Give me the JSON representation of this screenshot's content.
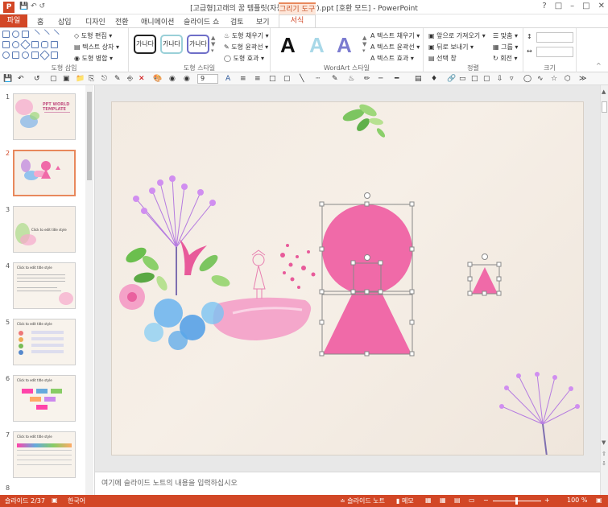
{
  "titlebar": {
    "title": "[고급형]고래의 꿈 템플릿(자동완성형포함).ppt [호환 모드] - PowerPoint",
    "help": "?",
    "min": "–",
    "max": "□",
    "close": "✕"
  },
  "tabs": {
    "file": "파일",
    "items": [
      "홈",
      "삽입",
      "디자인",
      "전환",
      "애니메이션",
      "슬라이드 쇼",
      "검토",
      "보기"
    ],
    "context_group": "그리기 도구",
    "active": "서식"
  },
  "ribbon": {
    "insert_shapes": {
      "label": "도형 삽입",
      "edit_shape": "도형 편집 ▾",
      "text_box": "텍스트 상자 ▾",
      "merge_shapes": "도형 병합 ▾"
    },
    "shape_styles": {
      "label": "도형 스타일",
      "preset_text": "가나다",
      "fill": "도형 채우기 ▾",
      "outline": "도형 윤곽선 ▾",
      "effects": "도형 효과 ▾"
    },
    "wordart": {
      "label": "WordArt 스타일",
      "letter": "A",
      "text_fill": "텍스트 채우기 ▾",
      "text_outline": "텍스트 윤곽선 ▾",
      "text_effects": "텍스트 효과 ▾"
    },
    "arrange": {
      "label": "정렬",
      "bring_forward": "앞으로 가져오기 ▾",
      "send_backward": "뒤로 보내기 ▾",
      "selection_pane": "선택 창",
      "align": "맞춤 ▾",
      "group": "그룹 ▾",
      "rotate": "회전 ▾"
    },
    "size": {
      "label": "크기"
    }
  },
  "toolbar2": {
    "zoom_value": "9"
  },
  "thumbnails": {
    "nums": [
      "1",
      "2",
      "3",
      "4",
      "5",
      "6",
      "7",
      "8"
    ],
    "thumb1_title": "PPT WORLD TEMPLATE",
    "thumb3_title": "Click to edit title style",
    "thumb_titles": [
      "Click to edit title style",
      "Click to edit title style",
      "Click to edit title style",
      "Click to edit title style"
    ]
  },
  "notes": {
    "placeholder": "여기에 슬라이드 노트의 내용을 입력하십시오"
  },
  "status": {
    "slide": "슬라이드 2/37",
    "language": "한국어",
    "notes_btn": "슬라이드 노트",
    "comments_btn": "메모",
    "zoom": "100 %"
  },
  "colors": {
    "accent": "#d24726",
    "pink": "#f06aa8",
    "pink_light": "#f48fc0"
  }
}
